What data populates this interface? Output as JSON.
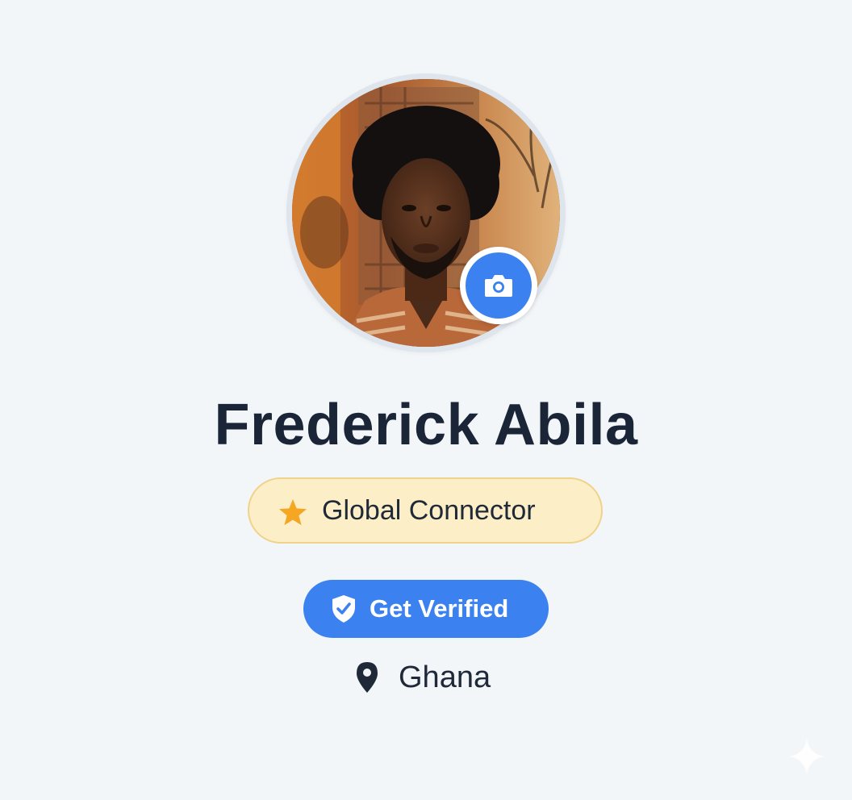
{
  "profile": {
    "name": "Frederick Abila",
    "badge": {
      "label": "Global Connector",
      "icon": "star-icon",
      "background": "#fcefc7",
      "border": "#efd38a",
      "star_color": "#f5a623"
    },
    "verify_button": {
      "label": "Get Verified",
      "icon": "shield-check-icon",
      "color": "#3b82f0"
    },
    "location": {
      "label": "Ghana",
      "icon": "map-pin-icon"
    },
    "avatar": {
      "edit_icon": "camera-icon"
    }
  },
  "colors": {
    "page_background": "#f3f6f9",
    "text_primary": "#1b2538",
    "accent": "#3b82f0"
  }
}
